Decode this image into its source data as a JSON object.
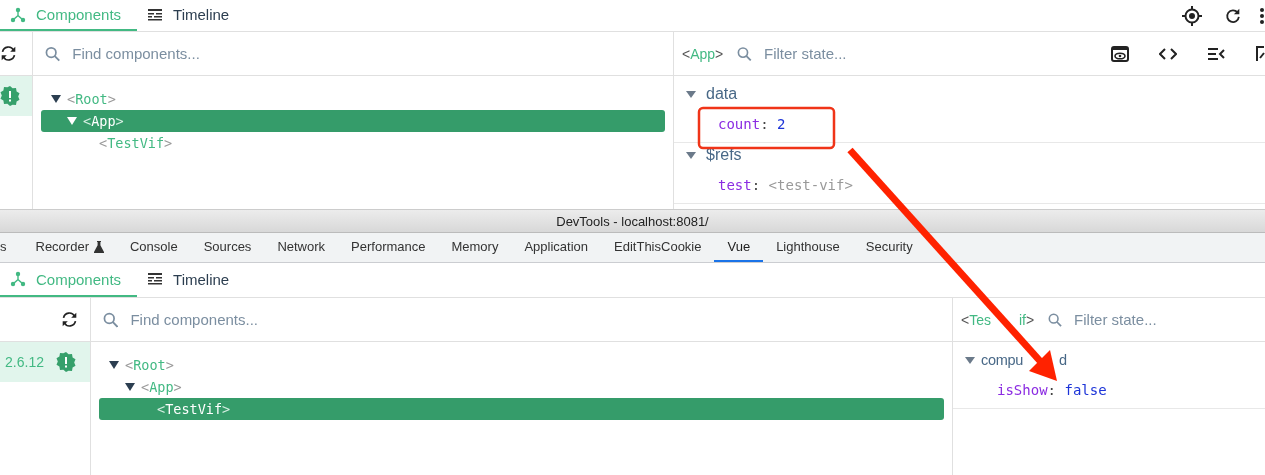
{
  "top_panel": {
    "tabs": [
      {
        "label": "Components",
        "selected": true
      },
      {
        "label": "Timeline",
        "selected": false
      }
    ],
    "search": {
      "placeholder": "Find components..."
    },
    "tree": [
      {
        "label": "<Root>",
        "expanded": true,
        "selected": false,
        "children": [
          {
            "label": "<App>",
            "expanded": true,
            "selected": true,
            "children": [
              {
                "label": "<TestVif>",
                "selected": false
              }
            ]
          }
        ]
      }
    ],
    "inspector": {
      "component": "<App>",
      "filter": {
        "placeholder": "Filter state..."
      },
      "sections": [
        {
          "title": "data",
          "expanded": true,
          "entries": [
            {
              "key": "count:",
              "value": "2",
              "kind": "number"
            }
          ]
        },
        {
          "title": "$refs",
          "expanded": true,
          "entries": [
            {
              "key": "test:",
              "value": "<test-vif>",
              "kind": "component"
            }
          ]
        }
      ]
    }
  },
  "devtools": {
    "title": "DevTools - localhost:8081/",
    "tabs": [
      {
        "label": "s",
        "selected": false
      },
      {
        "label": "Recorder",
        "selected": false,
        "kind": "experimental"
      },
      {
        "label": "Console",
        "selected": false
      },
      {
        "label": "Sources",
        "selected": false
      },
      {
        "label": "Network",
        "selected": false
      },
      {
        "label": "Performance",
        "selected": false
      },
      {
        "label": "Memory",
        "selected": false
      },
      {
        "label": "Application",
        "selected": false
      },
      {
        "label": "EditThisCookie",
        "selected": false
      },
      {
        "label": "Vue",
        "selected": true
      },
      {
        "label": "Lighthouse",
        "selected": false
      },
      {
        "label": "Security",
        "selected": false
      }
    ]
  },
  "bottom_panel": {
    "tabs": [
      {
        "label": "Components",
        "selected": true
      },
      {
        "label": "Timeline",
        "selected": false
      }
    ],
    "version": "2.6.12",
    "search": {
      "placeholder": "Find components..."
    },
    "tree": [
      {
        "label": "<Root>",
        "expanded": true,
        "selected": false,
        "children": [
          {
            "label": "<App>",
            "expanded": true,
            "selected": false,
            "children": [
              {
                "label": "<TestVif>",
                "selected": true
              }
            ]
          }
        ]
      }
    ],
    "inspector": {
      "component": "<Tes",
      "component_tail": "if>",
      "filter": {
        "placeholder": "Filter state..."
      },
      "sections": [
        {
          "title": "compu",
          "title_tail": "d",
          "expanded": true,
          "entries": [
            {
              "key": "isShow:",
              "value": "false",
              "kind": "boolean"
            }
          ]
        }
      ]
    }
  }
}
